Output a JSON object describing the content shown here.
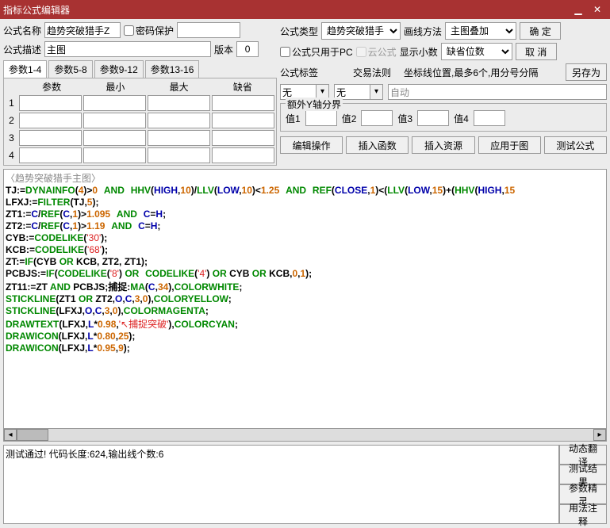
{
  "title": "指标公式编辑器",
  "labels": {
    "formula_name": "公式名称",
    "password_protect": "密码保护",
    "formula_desc": "公式描述",
    "version": "版本",
    "formula_type": "公式类型",
    "draw_method": "画线方法",
    "formula_pc_only": "公式只用于PC",
    "cloud_formula": "云公式",
    "show_decimal": "显示小数",
    "formula_tag": "公式标签",
    "trade_rule": "交易法则",
    "coord_hint": "坐标线位置,最多6个,用分号分隔",
    "extra_yaxis": "额外Y轴分界",
    "val1": "值1",
    "val2": "值2",
    "val3": "值3",
    "val4": "值4"
  },
  "values": {
    "formula_name": "趋势突破猎手Z",
    "formula_desc": "主图",
    "version": "0",
    "formula_type": "趋势突破猎手",
    "draw_method": "主图叠加",
    "show_decimal": "缺省位数",
    "formula_tag": "无",
    "trade_rule": "无",
    "coord_auto": "自动"
  },
  "buttons": {
    "ok": "确 定",
    "cancel": "取 消",
    "save_as": "另存为",
    "edit_op": "编辑操作",
    "insert_fn": "插入函数",
    "insert_res": "插入资源",
    "apply_chart": "应用于图",
    "test_formula": "测试公式",
    "dyn_trans": "动态翻译",
    "test_result": "测试结果",
    "param_wizard": "参数精灵",
    "usage_note": "用法注释"
  },
  "tabs": [
    "参数1-4",
    "参数5-8",
    "参数9-12",
    "参数13-16"
  ],
  "param_headers": [
    "参数",
    "最小",
    "最大",
    "缺省"
  ],
  "status": "测试通过! 代码长度:624,输出线个数:6",
  "code_title": "〈趋势突破猎手主图〉",
  "chart_data": {
    "type": "table",
    "note": "Formula source code tokens - stock indicator script",
    "lines": [
      "TJ:=DYNAINFO(4)>0 AND HHV(HIGH,10)/LLV(LOW,10)<1.25 AND REF(CLOSE,1)<(LLV(LOW,15)+(HHV(HIGH,15",
      "LFXJ:=FILTER(TJ,5);",
      "ZT1:=C/REF(C,1)>1.095 AND C=H;",
      "ZT2:=C/REF(C,1)>1.19 AND C=H;",
      "CYB:=CODELIKE('30');",
      "KCB:=CODELIKE('68');",
      "ZT:=IF(CYB OR KCB, ZT2, ZT1);",
      "PCBJS:=IF(CODELIKE('8') OR CODELIKE('4') OR CYB OR KCB,0,1);",
      "ZT11:=ZT AND PCBJS;捕捉:MA(C,34),COLORWHITE;",
      "STICKLINE(ZT1 OR ZT2,O,C,3,0),COLORYELLOW;",
      "STICKLINE(LFXJ,O,C,3,0),COLORMAGENTA;",
      "DRAWTEXT(LFXJ,L*0.98,'↖捕捉突破'),COLORCYAN;",
      "DRAWICON(LFXJ,L*0.80,25);",
      "DRAWICON(LFXJ,L*0.95,9);"
    ]
  }
}
